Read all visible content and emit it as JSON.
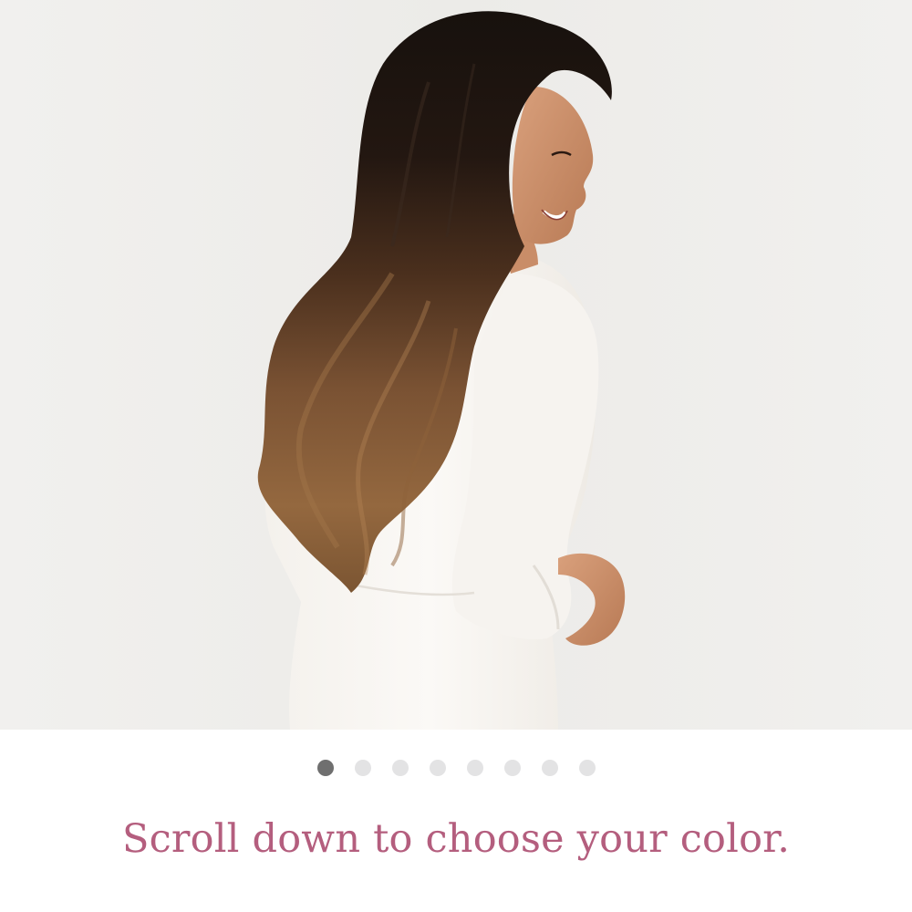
{
  "hero": {
    "image_alt": "Model with long ombre wavy hair in a white dress",
    "background_color": "#efeeeb"
  },
  "carousel": {
    "dot_count": 8,
    "active_index": 0,
    "active_color": "#6f6f6f",
    "inactive_color": "#e3e3e4"
  },
  "caption": {
    "text": "Scroll down to choose your color.",
    "color": "#b45e7e"
  }
}
